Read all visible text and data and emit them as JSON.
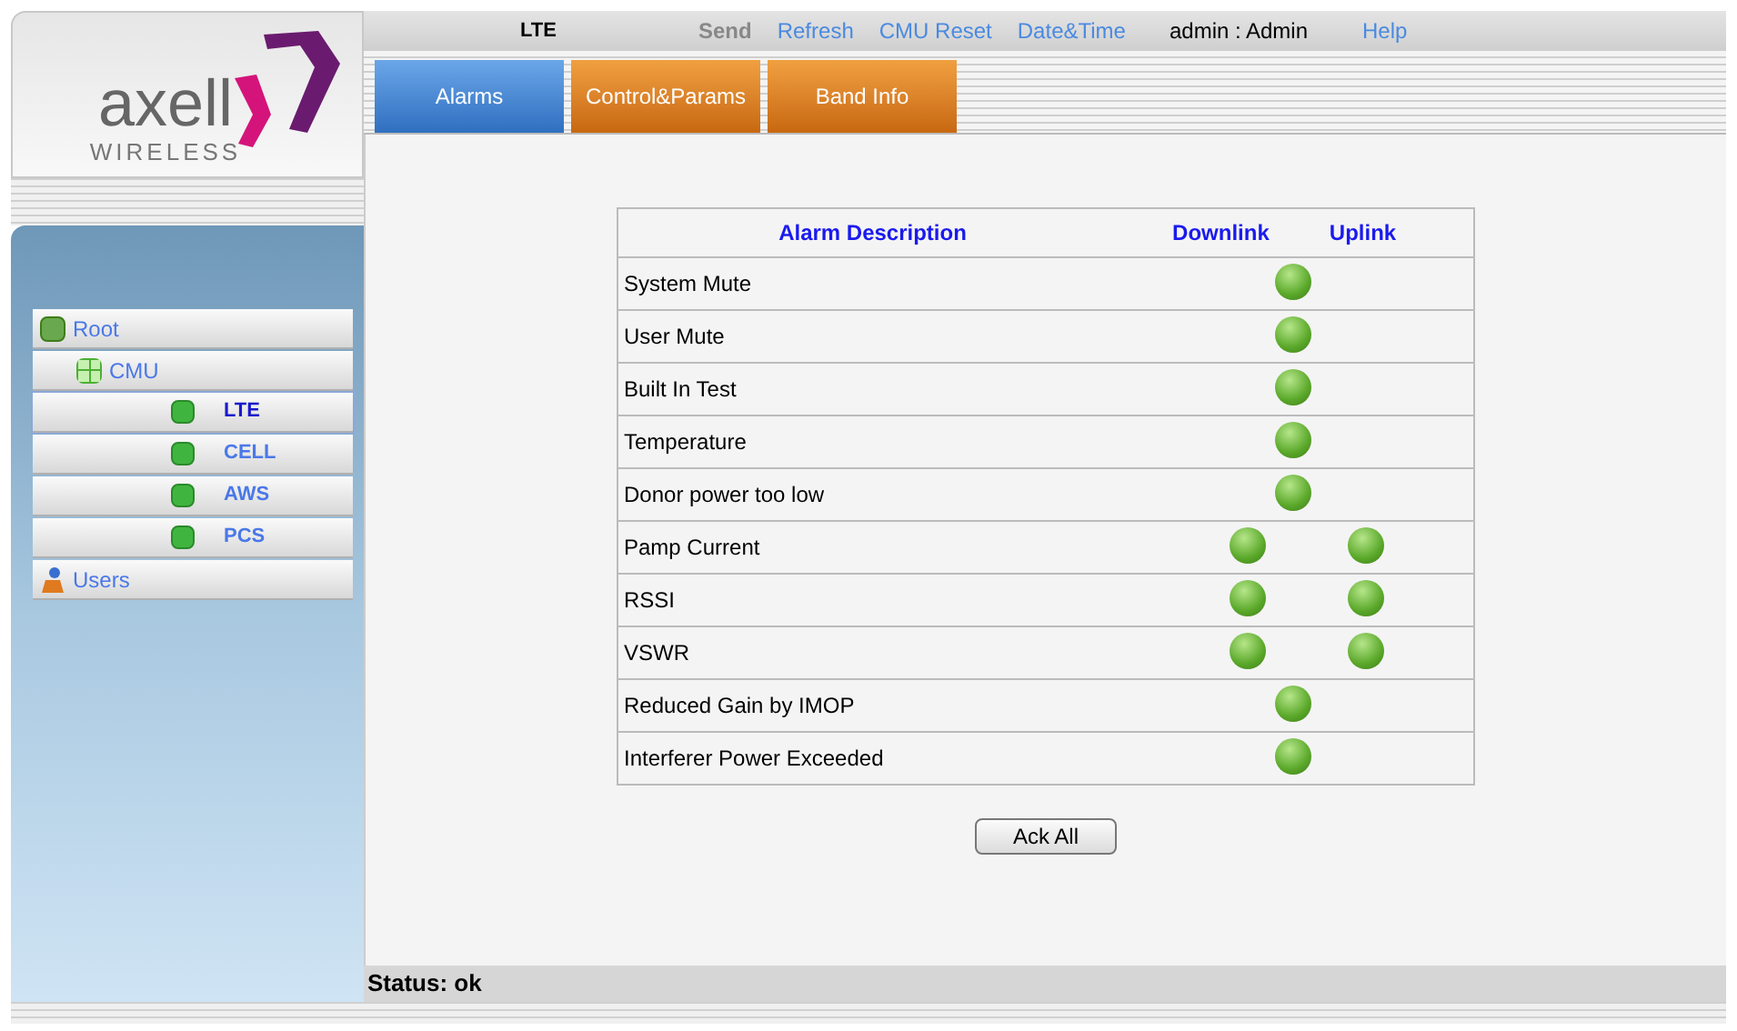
{
  "logo": {
    "name": "axell",
    "tagline": "WIRELESS"
  },
  "top_bar": {
    "device": "LTE",
    "links": [
      {
        "label": "Send",
        "disabled": true
      },
      {
        "label": "Refresh",
        "disabled": false
      },
      {
        "label": "CMU Reset",
        "disabled": false
      },
      {
        "label": "Date&Time",
        "disabled": false
      }
    ],
    "user": "admin : Admin",
    "help": "Help"
  },
  "tabs": [
    {
      "label": "Alarms",
      "selected": true
    },
    {
      "label": "Control&Params",
      "selected": false
    },
    {
      "label": "Band Info",
      "selected": false
    }
  ],
  "tree": [
    {
      "label": "Root",
      "kind": "root",
      "selected": false,
      "children": [
        {
          "label": "CMU",
          "kind": "group",
          "selected": false,
          "children": [
            {
              "label": "LTE",
              "kind": "module",
              "selected": true
            },
            {
              "label": "CELL",
              "kind": "module",
              "selected": false
            },
            {
              "label": "AWS",
              "kind": "module",
              "selected": false
            },
            {
              "label": "PCS",
              "kind": "module",
              "selected": false
            }
          ]
        }
      ]
    },
    {
      "label": "Users",
      "kind": "users",
      "selected": false
    }
  ],
  "table": {
    "columns": [
      "Alarm Description",
      "Downlink",
      "Uplink"
    ],
    "rows": [
      {
        "description": "System Mute",
        "kind": "combined"
      },
      {
        "description": "User Mute",
        "kind": "combined"
      },
      {
        "description": "Built In Test",
        "kind": "combined"
      },
      {
        "description": "Temperature",
        "kind": "combined"
      },
      {
        "description": "Donor power too low",
        "kind": "combined"
      },
      {
        "description": "Pamp Current",
        "kind": "split"
      },
      {
        "description": "RSSI",
        "kind": "split"
      },
      {
        "description": "VSWR",
        "kind": "split"
      },
      {
        "description": "Reduced Gain by IMOP",
        "kind": "combined"
      },
      {
        "description": "Interferer Power Exceeded",
        "kind": "combined"
      }
    ]
  },
  "ack_button": "Ack All",
  "status_bar": "Status: ok"
}
